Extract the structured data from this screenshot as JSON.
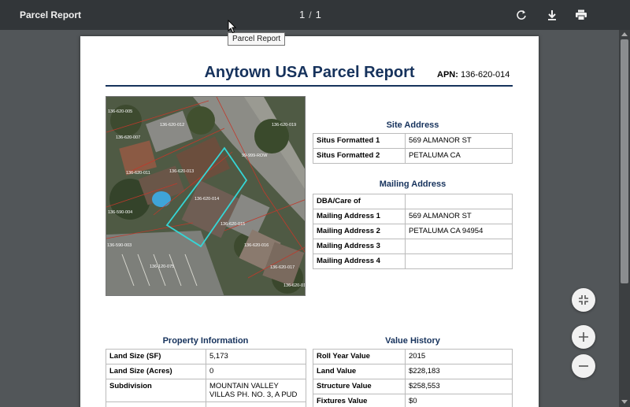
{
  "toolbar": {
    "title": "Parcel Report",
    "page_current": "1",
    "page_separator": "/",
    "page_total": "1",
    "tooltip": "Parcel Report"
  },
  "report": {
    "title": "Anytown USA Parcel Report",
    "apn_label": "APN:",
    "apn_value": "136-620-014"
  },
  "map_labels": [
    "136-620-005",
    "136-620-012",
    "136-620-019",
    "136-620-007",
    "136-620-013",
    "99-999-ROW",
    "136-620-011",
    "136-620-014",
    "136-590-004",
    "136-620-015",
    "136-590-003",
    "136-620-016",
    "136-120-075",
    "136-620-017",
    "136-620-018"
  ],
  "site_address": {
    "title": "Site Address",
    "rows": [
      {
        "k": "Situs Formatted 1",
        "v": "569 ALMANOR ST"
      },
      {
        "k": "Situs Formatted 2",
        "v": "PETALUMA CA"
      }
    ]
  },
  "mailing_address": {
    "title": "Mailing Address",
    "rows": [
      {
        "k": "DBA/Care of",
        "v": ""
      },
      {
        "k": "Mailing Address 1",
        "v": "569 ALMANOR ST"
      },
      {
        "k": "Mailing Address 2",
        "v": "PETALUMA CA 94954"
      },
      {
        "k": "Mailing Address 3",
        "v": ""
      },
      {
        "k": "Mailing Address 4",
        "v": ""
      }
    ]
  },
  "property_info": {
    "title": "Property Information",
    "rows": [
      {
        "k": "Land Size (SF)",
        "v": "5,173"
      },
      {
        "k": "Land Size (Acres)",
        "v": "0"
      },
      {
        "k": "Subdivision",
        "v": "MOUNTAIN VALLEY VILLAS PH. NO. 3, A PUD"
      },
      {
        "k": "",
        "v": ""
      }
    ]
  },
  "value_history": {
    "title": "Value History",
    "rows": [
      {
        "k": "Roll Year Value",
        "v": "2015"
      },
      {
        "k": "Land Value",
        "v": "$228,183"
      },
      {
        "k": "Structure Value",
        "v": "$258,553"
      },
      {
        "k": "Fixtures Value",
        "v": "$0"
      }
    ]
  },
  "icons": {
    "rotate": "rotate-icon",
    "download": "download-icon",
    "print": "print-icon",
    "fit": "fit-page-icon",
    "zoom_in": "zoom-in-icon",
    "zoom_out": "zoom-out-icon"
  },
  "colors": {
    "toolbar_bg": "#323639",
    "viewer_bg": "#525659",
    "title_navy": "#16325c",
    "parcel_highlight": "#35d6d6",
    "parcel_lines": "#c0392b"
  }
}
